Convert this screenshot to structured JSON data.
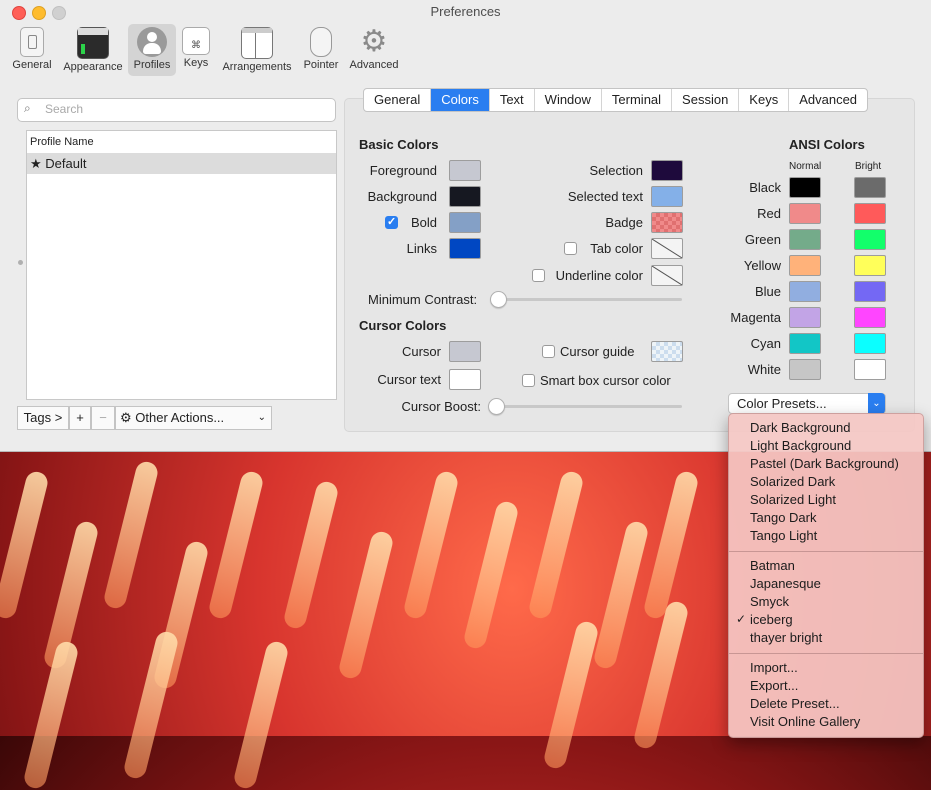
{
  "window": {
    "title": "Preferences"
  },
  "toolbar": {
    "items": [
      {
        "label": "General",
        "icon": "switch-icon"
      },
      {
        "label": "Appearance",
        "icon": "window-icon"
      },
      {
        "label": "Profiles",
        "icon": "user-icon"
      },
      {
        "label": "Keys",
        "icon": "keyboard-icon"
      },
      {
        "label": "Arrangements",
        "icon": "windows-icon"
      },
      {
        "label": "Pointer",
        "icon": "mouse-icon"
      },
      {
        "label": "Advanced",
        "icon": "gear-icon"
      }
    ],
    "active": "Profiles"
  },
  "profiles": {
    "search_placeholder": "Search",
    "column_header": "Profile Name",
    "rows": [
      {
        "name": "Default",
        "default": true
      }
    ],
    "tags_label": "Tags >",
    "add_label": "+",
    "remove_label": "−",
    "other_actions_label": "Other Actions..."
  },
  "tabs": [
    "General",
    "Colors",
    "Text",
    "Window",
    "Terminal",
    "Session",
    "Keys",
    "Advanced"
  ],
  "selected_tab": "Colors",
  "basic": {
    "header": "Basic Colors",
    "foreground": "Foreground",
    "background": "Background",
    "bold": "Bold",
    "links": "Links",
    "selection": "Selection",
    "selected_text": "Selected text",
    "badge": "Badge",
    "tab_color": "Tab color",
    "underline_color": "Underline color",
    "min_contrast": "Minimum Contrast:",
    "colors": {
      "foreground": "#c6c8d1",
      "background": "#161821",
      "bold": "#84a0c6",
      "links": "#0047c2",
      "selection": "#1e0a3c",
      "selected_text": "#84b0e8",
      "badge": "#f08a8a"
    }
  },
  "cursor": {
    "header": "Cursor Colors",
    "cursor": "Cursor",
    "cursor_text": "Cursor text",
    "cursor_guide": "Cursor guide",
    "smart_box": "Smart box cursor color",
    "boost": "Cursor Boost:",
    "colors": {
      "cursor": "#c6c8d1",
      "cursor_text": "#ffffff"
    }
  },
  "ansi": {
    "header": "ANSI Colors",
    "normal": "Normal",
    "bright": "Bright",
    "rows": [
      {
        "name": "Black",
        "normal": "#000000",
        "bright": "#6b6b6b"
      },
      {
        "name": "Red",
        "normal": "#f08a8a",
        "bright": "#ff5a5a"
      },
      {
        "name": "Green",
        "normal": "#74ab8a",
        "bright": "#12ff6b"
      },
      {
        "name": "Yellow",
        "normal": "#ffb27a",
        "bright": "#ffff5a"
      },
      {
        "name": "Blue",
        "normal": "#91aee0",
        "bright": "#7468f4"
      },
      {
        "name": "Magenta",
        "normal": "#c2a4e6",
        "bright": "#ff45ff"
      },
      {
        "name": "Cyan",
        "normal": "#12c6c6",
        "bright": "#0bffff"
      },
      {
        "name": "White",
        "normal": "#c6c6c6",
        "bright": "#ffffff"
      }
    ]
  },
  "presets": {
    "button_label": "Color Presets...",
    "group1": [
      "Dark Background",
      "Light Background",
      "Pastel (Dark Background)",
      "Solarized Dark",
      "Solarized Light",
      "Tango Dark",
      "Tango Light"
    ],
    "group2": [
      "Batman",
      "Japanesque",
      "Smyck",
      "iceberg",
      "thayer bright"
    ],
    "checked": "iceberg",
    "group3": [
      "Import...",
      "Export...",
      "Delete Preset...",
      "Visit Online Gallery"
    ]
  }
}
